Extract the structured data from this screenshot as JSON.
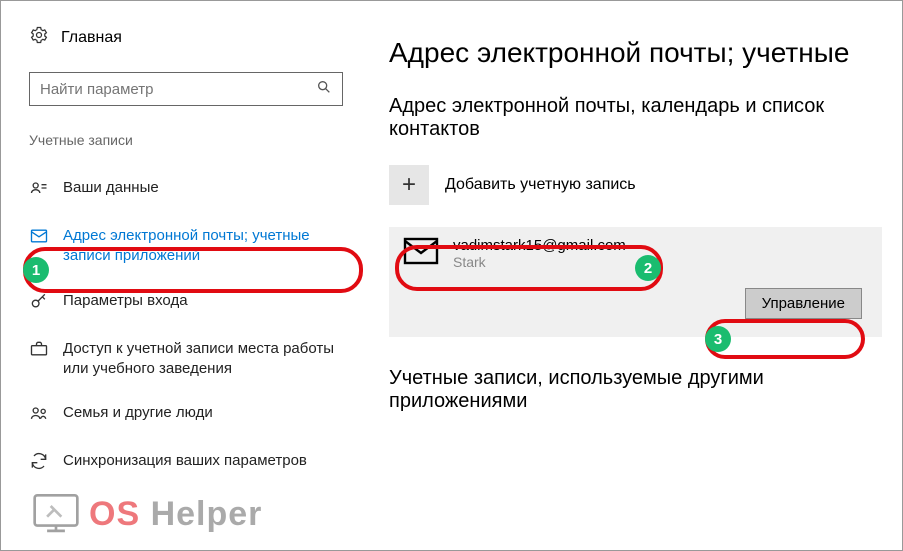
{
  "sidebar": {
    "home_label": "Главная",
    "search_placeholder": "Найти параметр",
    "section_label": "Учетные записи",
    "items": [
      {
        "label": "Ваши данные"
      },
      {
        "label": "Адрес электронной почты; учетные записи приложений"
      },
      {
        "label": "Параметры входа"
      },
      {
        "label": "Доступ к учетной записи места работы или учебного заведения"
      },
      {
        "label": "Семья и другие люди"
      },
      {
        "label": "Синхронизация ваших параметров"
      }
    ]
  },
  "main": {
    "title": "Адрес электронной почты; учетные",
    "section1_heading": "Адрес электронной почты, календарь и список контактов",
    "add_label": "Добавить учетную запись",
    "account_email": "vadimstark15@gmail.com",
    "account_name": "Stark",
    "manage_label": "Управление",
    "section2_heading": "Учетные записи, используемые другими приложениями"
  },
  "annotations": {
    "badge1": "1",
    "badge2": "2",
    "badge3": "3"
  },
  "watermark": {
    "part1": "OS",
    "part2": "Helper"
  }
}
